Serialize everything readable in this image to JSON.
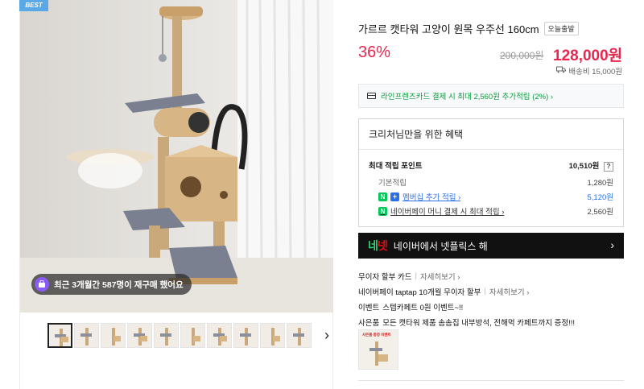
{
  "badge": {
    "best": "BEST"
  },
  "gallery": {
    "recent_notice": "최근 3개월간 587명이 재구매 했어요",
    "thumbnail_count": 10,
    "next_label": "›"
  },
  "product": {
    "title": "가르르 캣타워 고양이 원목 우주선 160cm",
    "today_tag": "오늘출발",
    "discount_rate": "36%",
    "original_price": "200,000원",
    "sale_price": "128,000원",
    "shipping": "배송비 15,000원"
  },
  "card_banner": {
    "text": "라인프렌즈카드 결제 시 최대 2,560원 추가적립 (2%) ›"
  },
  "benefit": {
    "heading": "크리처님만을 위한 혜택",
    "max_points_label": "최대 적립 포인트",
    "max_points_value": "10,510원",
    "help_label": "?",
    "rows": [
      {
        "label": "기본적립",
        "value": "1,280원"
      },
      {
        "label": "멤버십 추가 적립 ›",
        "value": "5,120원"
      },
      {
        "label": "네이버페이 머니 결제 시 최대 적립 ›",
        "value": "2,560원"
      }
    ]
  },
  "netflix_banner": {
    "logo_a": "네",
    "logo_b": "넷",
    "text": "네이버에서 넷플릭스 해",
    "arrow": "›"
  },
  "info": {
    "installment": {
      "label": "무이자 할부 카드",
      "more": "자세히보기 ›"
    },
    "taptap": {
      "label": "네이버페이 taptap 10개월 무이자 할부",
      "more": "자세히보기 ›"
    },
    "event": {
      "label": "이벤트",
      "value": "스텝카페트 0원 이벤트~!!"
    },
    "gift": {
      "label": "사은품",
      "value": "모든 캣타워 제품 솜솜집 내부방석, 전해먹 카페트까지 증정!!!"
    },
    "gift_thumb_text": "사은품 증정 이벤트"
  },
  "colors": {
    "accent_red": "#e8264e",
    "naver_green": "#03c75a",
    "membership_blue": "#2a6fe8"
  }
}
